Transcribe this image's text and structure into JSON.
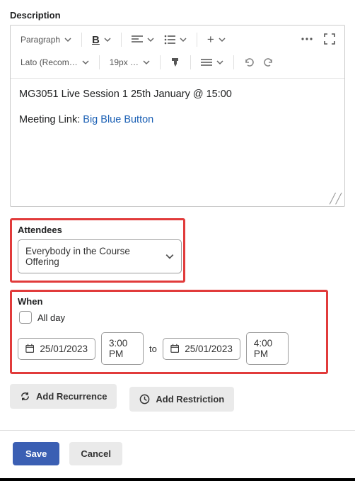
{
  "description": {
    "label": "Description",
    "toolbar": {
      "paragraph": "Paragraph",
      "font": "Lato (Recom…",
      "size": "19px …"
    },
    "content": {
      "line1": "MG3051 Live Session 1 25th January @ 15:00",
      "line2_prefix": "Meeting Link: ",
      "line2_link": "Big Blue Button"
    }
  },
  "attendees": {
    "label": "Attendees",
    "selected": "Everybody in the Course Offering"
  },
  "when": {
    "label": "When",
    "all_day_label": "All day",
    "start_date": "25/01/2023",
    "start_time": "3:00 PM",
    "to_label": "to",
    "end_date": "25/01/2023",
    "end_time": "4:00 PM"
  },
  "actions": {
    "recurrence": "Add Recurrence",
    "restriction": "Add Restriction"
  },
  "footer": {
    "save": "Save",
    "cancel": "Cancel"
  }
}
